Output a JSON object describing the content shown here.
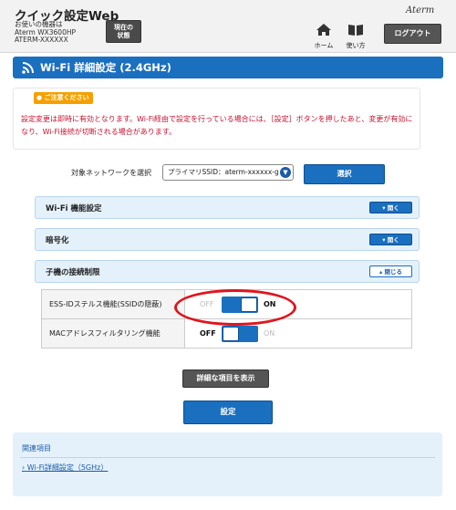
{
  "header": {
    "app_title": "クイック設定Web",
    "device_caption": "お使いの機器は",
    "device_model": "Aterm WX3600HP",
    "device_ssid": "ATERM-XXXXXX",
    "status_button_line1": "現在の",
    "status_button_line2": "状態",
    "brand": "Aterm",
    "home_label": "ホーム",
    "help_label": "使い方",
    "logout_label": "ログアウト"
  },
  "page": {
    "title": "Wi-Fi 詳細設定 (2.4GHz)",
    "accent_color": "#1a6fbf"
  },
  "notice": {
    "badge": "ご注意ください",
    "text": "設定変更は即時に有効となります。Wi-Fi経由で設定を行っている場合には、［設定］ボタンを押したあと、変更が有効になり、Wi-Fi接続が切断される場合があります。",
    "text_color": "#c8102e"
  },
  "network_select": {
    "label": "対象ネットワークを選択",
    "selected": "プライマリSSID：aterm-xxxxxx-g",
    "button": "選択"
  },
  "sections": [
    {
      "title": "Wi-Fi 機能設定",
      "toggle": "開く",
      "expanded": false
    },
    {
      "title": "暗号化",
      "toggle": "開く",
      "expanded": false
    },
    {
      "title": "子機の接続制限",
      "toggle": "閉じる",
      "expanded": true
    }
  ],
  "settings": [
    {
      "label": "ESS-IDステルス機能(SSIDの隠蔽)",
      "off": "OFF",
      "on": "ON",
      "state": "on"
    },
    {
      "label": "MACアドレスフィルタリング機能",
      "off": "OFF",
      "on": "ON",
      "state": "off"
    }
  ],
  "actions": {
    "show_details": "詳細な項目を表示",
    "submit": "設定"
  },
  "related": {
    "title": "関連項目",
    "link": "Wi-Fi詳細設定（5GHz）"
  }
}
